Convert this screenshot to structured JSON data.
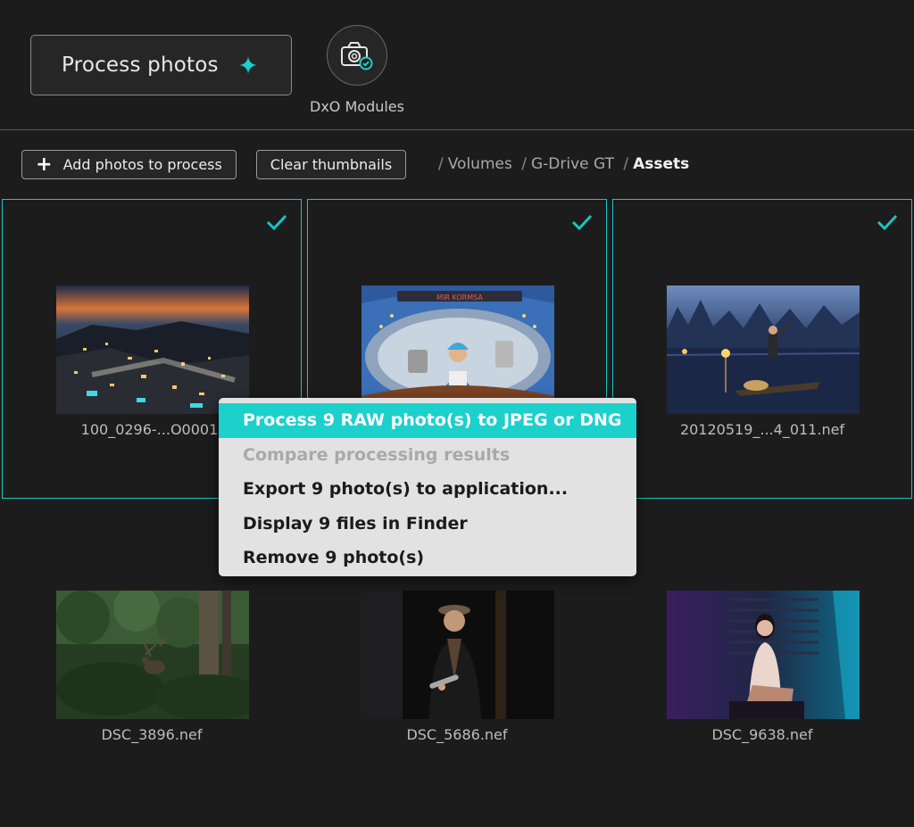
{
  "toolbar": {
    "process_label": "Process photos",
    "modules_label": "DxO Modules"
  },
  "subbar": {
    "add_label": "Add photos to process",
    "clear_label": "Clear thumbnails",
    "breadcrumb": [
      "Volumes",
      "G-Drive GT",
      "Assets"
    ]
  },
  "photos": [
    {
      "name": "100_0296-...O0001.",
      "selected": true
    },
    {
      "name": "",
      "selected": true
    },
    {
      "name": "20120519_...4_011.nef",
      "selected": true
    },
    {
      "name": "DSC_3896.nef",
      "selected": false
    },
    {
      "name": "DSC_5686.nef",
      "selected": false
    },
    {
      "name": "DSC_9638.nef",
      "selected": false
    }
  ],
  "context_menu": {
    "items": [
      {
        "label": "Process 9 RAW photo(s) to JPEG or DNG",
        "state": "highlighted"
      },
      {
        "label": "Compare processing results",
        "state": "disabled"
      },
      {
        "label": "Export 9 photo(s) to application...",
        "state": "enabled"
      },
      {
        "label": "Display 9 files in Finder",
        "state": "enabled"
      },
      {
        "label": "Remove 9 photo(s)",
        "state": "enabled"
      }
    ]
  },
  "colors": {
    "accent": "#1cd0cc",
    "background": "#1c1c1c"
  },
  "icons": [
    "sparkle-icon",
    "camera-modules-icon",
    "plus-icon",
    "checkmark-icon"
  ]
}
